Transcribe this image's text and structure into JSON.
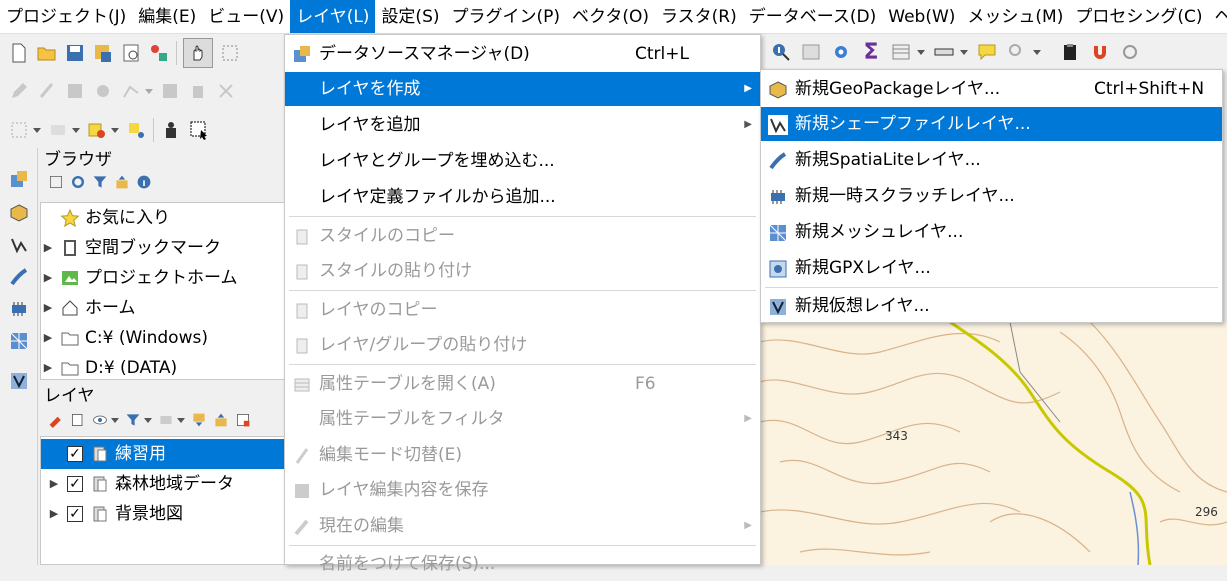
{
  "menubar": {
    "items": [
      "プロジェクト(J)",
      "編集(E)",
      "ビュー(V)",
      "レイヤ(L)",
      "設定(S)",
      "プラグイン(P)",
      "ベクタ(O)",
      "ラスタ(R)",
      "データベース(D)",
      "Web(W)",
      "メッシュ(M)",
      "プロセシング(C)",
      "ヘルプ("
    ],
    "active_index": 3
  },
  "browser": {
    "title": "ブラウザ",
    "items": [
      {
        "label": "お気に入り",
        "icon": "star-icon",
        "expandable": false
      },
      {
        "label": "空間ブックマーク",
        "icon": "bookmark-icon",
        "expandable": true
      },
      {
        "label": "プロジェクトホーム",
        "icon": "project-home-icon",
        "expandable": true
      },
      {
        "label": "ホーム",
        "icon": "home-icon",
        "expandable": true
      },
      {
        "label": "C:¥ (Windows)",
        "icon": "drive-icon",
        "expandable": true
      },
      {
        "label": "D:¥ (DATA)",
        "icon": "drive-icon",
        "expandable": true
      }
    ]
  },
  "layers": {
    "title": "レイヤ",
    "items": [
      {
        "label": "練習用",
        "checked": true,
        "selected": true,
        "expandable": false
      },
      {
        "label": "森林地域データ",
        "checked": true,
        "selected": false,
        "expandable": true
      },
      {
        "label": "背景地図",
        "checked": true,
        "selected": false,
        "expandable": true
      }
    ]
  },
  "layer_menu": {
    "items": [
      {
        "label": "データソースマネージャ(D)",
        "shortcut": "Ctrl+L",
        "icon": "data-source-manager-icon",
        "state": "normal"
      },
      {
        "label": "レイヤを作成",
        "submenu": true,
        "state": "highlighted"
      },
      {
        "label": "レイヤを追加",
        "submenu": true,
        "state": "normal"
      },
      {
        "label": "レイヤとグループを埋め込む...",
        "state": "normal"
      },
      {
        "label": "レイヤ定義ファイルから追加...",
        "state": "normal"
      },
      {
        "label": "スタイルのコピー",
        "icon": "copy-icon",
        "state": "disabled"
      },
      {
        "label": "スタイルの貼り付け",
        "icon": "paste-icon",
        "state": "disabled"
      },
      {
        "label": "レイヤのコピー",
        "icon": "copy-icon",
        "state": "disabled"
      },
      {
        "label": "レイヤ/グループの貼り付け",
        "icon": "paste-icon",
        "state": "disabled"
      },
      {
        "label": "属性テーブルを開く(A)",
        "shortcut": "F6",
        "icon": "table-icon",
        "state": "disabled"
      },
      {
        "label": "属性テーブルをフィルタ",
        "submenu": true,
        "state": "disabled"
      },
      {
        "label": "編集モード切替(E)",
        "icon": "pencil-icon",
        "state": "disabled"
      },
      {
        "label": "レイヤ編集内容を保存",
        "icon": "save-edits-icon",
        "state": "disabled"
      },
      {
        "label": "現在の編集",
        "submenu": true,
        "icon": "edit-current-icon",
        "state": "disabled"
      },
      {
        "label": "名前をつけて保存(S)...",
        "state": "disabled"
      }
    ]
  },
  "create_layer_submenu": {
    "items": [
      {
        "label": "新規GeoPackageレイヤ...",
        "shortcut": "Ctrl+Shift+N",
        "icon": "geopackage-icon",
        "state": "normal"
      },
      {
        "label": "新規シェープファイルレイヤ...",
        "icon": "shapefile-icon",
        "state": "highlighted"
      },
      {
        "label": "新規SpatiaLiteレイヤ...",
        "icon": "spatialite-icon",
        "state": "normal"
      },
      {
        "label": "新規一時スクラッチレイヤ...",
        "icon": "scratch-layer-icon",
        "state": "normal"
      },
      {
        "label": "新規メッシュレイヤ...",
        "icon": "mesh-icon",
        "state": "normal"
      },
      {
        "label": "新規GPXレイヤ...",
        "icon": "gpx-icon",
        "state": "normal"
      },
      {
        "label": "新規仮想レイヤ...",
        "icon": "virtual-layer-icon",
        "state": "normal"
      }
    ]
  },
  "map": {
    "labels": [
      "343",
      "296"
    ]
  },
  "colors": {
    "accent": "#0078d7",
    "map_background": "#fbf2e0",
    "contour": "#d9b38c",
    "road": "#c8c800"
  }
}
